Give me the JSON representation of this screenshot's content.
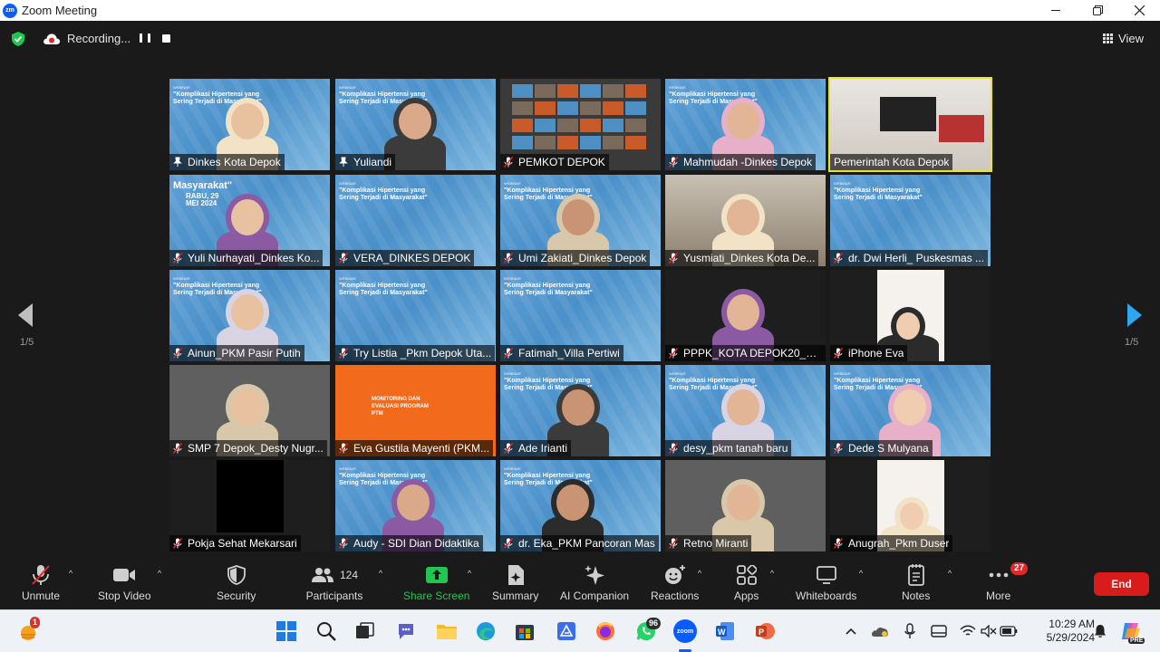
{
  "window": {
    "title": "Zoom Meeting",
    "logo_text": "zm",
    "controls": [
      "minimize",
      "restore",
      "close"
    ]
  },
  "topbar": {
    "recording_label": "Recording...",
    "view_label": "View"
  },
  "pagination": {
    "left_label": "1/5",
    "right_label": "1/5"
  },
  "participants": [
    {
      "name": "Dinkes Kota Depok",
      "mic": "pinned",
      "bg": "webinar"
    },
    {
      "name": "Yuliandi",
      "mic": "pinned",
      "bg": "webinar"
    },
    {
      "name": "PEMKOT DEPOK",
      "mic": "muted",
      "bg": "gallery"
    },
    {
      "name": "Mahmudah -Dinkes Depok",
      "mic": "muted",
      "bg": "webinar"
    },
    {
      "name": "Pemerintah Kota Depok",
      "mic": "active",
      "bg": "room"
    },
    {
      "name": "Yuli Nurhayati_Dinkes Ko...",
      "mic": "muted",
      "bg": "webinar"
    },
    {
      "name": "VERA_DINKES DEPOK",
      "mic": "muted",
      "bg": "webinar"
    },
    {
      "name": "Umi Zakiati_Dinkes Depok",
      "mic": "muted",
      "bg": "webinar"
    },
    {
      "name": "Yusmiati_Dinkes Kota De...",
      "mic": "muted",
      "bg": "office"
    },
    {
      "name": "dr. Dwi Herli_ Puskesmas ...",
      "mic": "muted",
      "bg": "webinar"
    },
    {
      "name": "Ainun_PKM Pasir Putih",
      "mic": "muted",
      "bg": "webinar"
    },
    {
      "name": "Try Listia _Pkm Depok Uta...",
      "mic": "muted",
      "bg": "webinar"
    },
    {
      "name": "Fatimah_Villa Pertiwi",
      "mic": "muted",
      "bg": "webinar"
    },
    {
      "name": "PPPK_KOTA DEPOK20_31...",
      "mic": "muted",
      "bg": "dark"
    },
    {
      "name": "iPhone Eva",
      "mic": "muted",
      "bg": "dark"
    },
    {
      "name": "SMP 7 Depok_Desty Nugr...",
      "mic": "muted",
      "bg": "grey"
    },
    {
      "name": "Eva Gustila Mayenti (PKM...",
      "mic": "muted",
      "bg": "orange"
    },
    {
      "name": "Ade Irianti",
      "mic": "muted",
      "bg": "webinar"
    },
    {
      "name": "desy_pkm tanah baru",
      "mic": "muted",
      "bg": "webinar"
    },
    {
      "name": "Dede S Mulyana",
      "mic": "muted",
      "bg": "webinar"
    },
    {
      "name": "Pokja Sehat Mekarsari",
      "mic": "muted",
      "bg": "dark"
    },
    {
      "name": "Audy - SDI Dian Didaktika",
      "mic": "muted",
      "bg": "webinar"
    },
    {
      "name": "dr. Eka_PKM Pancoran Mas",
      "mic": "muted",
      "bg": "webinar"
    },
    {
      "name": "Retno Miranti",
      "mic": "muted",
      "bg": "grey"
    },
    {
      "name": "Anugrah_Pkm Duser",
      "mic": "muted",
      "bg": "dark"
    }
  ],
  "slide": {
    "webinar": "WEBINAR",
    "topic": "\"Komplikasi Hipertensi yang Sering Terjadi di Masyarakat\"",
    "masyarakat": "Masyarakat\"",
    "date": "RABU, 29 MEI 2024",
    "orange_title": "MONITORING DAN EVALUASI PROGRAM PTM"
  },
  "toolbar": {
    "unmute": "Unmute",
    "stop_video": "Stop Video",
    "security": "Security",
    "participants": "Participants",
    "participants_count": "124",
    "share_screen": "Share Screen",
    "summary": "Summary",
    "ai_companion": "AI Companion",
    "reactions": "Reactions",
    "apps": "Apps",
    "whiteboards": "Whiteboards",
    "notes": "Notes",
    "more": "More",
    "more_badge": "27",
    "end": "End"
  },
  "taskbar": {
    "weather_badge": "1",
    "whatsapp_badge": "96",
    "time": "10:29 AM",
    "date": "5/29/2024",
    "zoom_label": "zoom",
    "pre_label": "PRE"
  },
  "colors": {
    "end_button": "#d81b1b",
    "share_screen": "#23c552",
    "active_speaker": "#e6e43a",
    "muted_mic": "#e02828"
  }
}
